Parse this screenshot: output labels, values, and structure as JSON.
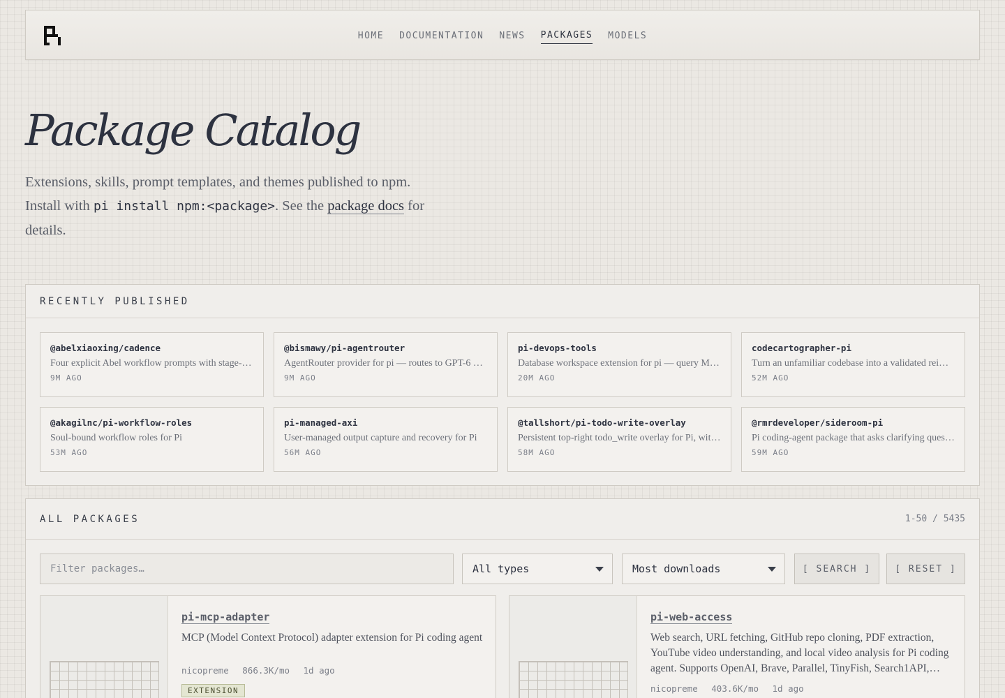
{
  "nav": {
    "logo": "pi-logo",
    "items": [
      {
        "label": "HOME",
        "active": false
      },
      {
        "label": "DOCUMENTATION",
        "active": false
      },
      {
        "label": "NEWS",
        "active": false
      },
      {
        "label": "PACKAGES",
        "active": true
      },
      {
        "label": "MODELS",
        "active": false
      }
    ]
  },
  "hero": {
    "title": "Package Catalog",
    "line1": "Extensions, skills, prompt templates, and themes published to npm.",
    "install_prefix": "Install with",
    "install_cmd": "pi install npm:<package>",
    "see_the": ". See the",
    "docs_link": "package docs",
    "suffix": "for details."
  },
  "recent": {
    "title": "RECENTLY PUBLISHED",
    "items": [
      {
        "name": "@abelxiaoxing/cadence",
        "desc": "Four explicit Abel workflow prompts with stage-i…",
        "time": "9M AGO"
      },
      {
        "name": "@bismawy/pi-agentrouter",
        "desc": "AgentRouter provider for pi — routes to GPT-6 …",
        "time": "9M AGO"
      },
      {
        "name": "pi-devops-tools",
        "desc": "Database workspace extension for pi — query My…",
        "time": "20M AGO"
      },
      {
        "name": "codecartographer-pi",
        "desc": "Turn an unfamiliar codebase into a validated reim…",
        "time": "52M AGO"
      },
      {
        "name": "@akagilnc/pi-workflow-roles",
        "desc": "Soul-bound workflow roles for Pi",
        "time": "53M AGO"
      },
      {
        "name": "pi-managed-axi",
        "desc": "User-managed output capture and recovery for Pi",
        "time": "56M AGO"
      },
      {
        "name": "@tallshort/pi-todo-write-overlay",
        "desc": "Persistent top-right todo_write overlay for Pi, wit…",
        "time": "58M AGO"
      },
      {
        "name": "@rmrdeveloper/sideroom-pi",
        "desc": "Pi coding-agent package that asks clarifying quest…",
        "time": "59M AGO"
      }
    ]
  },
  "all": {
    "title": "ALL PACKAGES",
    "count": "1-50 / 5435",
    "filter_placeholder": "Filter packages…",
    "type_select": "All types",
    "sort_select": "Most downloads",
    "search_btn": "[ SEARCH ]",
    "reset_btn": "[ RESET ]",
    "packages": [
      {
        "name": "pi-mcp-adapter",
        "desc": "MCP (Model Context Protocol) adapter extension for Pi coding agent",
        "author": "nicopreme",
        "downloads": "866.3K/mo",
        "updated": "1d ago",
        "badge": "EXTENSION"
      },
      {
        "name": "pi-web-access",
        "desc": "Web search, URL fetching, GitHub repo cloning, PDF extraction, YouTube video understanding, and local video analysis for Pi coding agent. Supports OpenAI, Brave, Parallel, TinyFish, Search1API,…",
        "author": "nicopreme",
        "downloads": "403.6K/mo",
        "updated": "1d ago"
      }
    ]
  }
}
